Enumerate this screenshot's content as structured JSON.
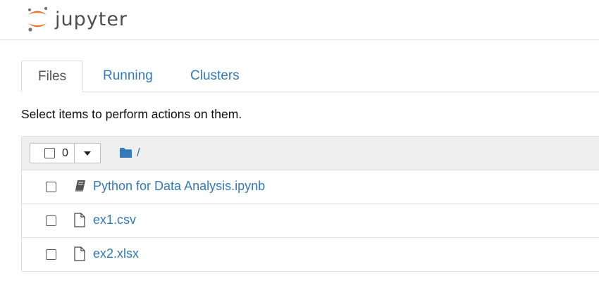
{
  "header": {
    "logo_text": "jupyter",
    "colors": {
      "logo_orange": "#f37626",
      "logo_gray": "#767677"
    }
  },
  "tabs": [
    {
      "label": "Files",
      "active": true
    },
    {
      "label": "Running",
      "active": false
    },
    {
      "label": "Clusters",
      "active": false
    }
  ],
  "instructions": "Select items to perform actions on them.",
  "toolbar": {
    "selected_count": "0",
    "breadcrumb_separator": "/"
  },
  "items": [
    {
      "name": "Python for Data Analysis.ipynb",
      "icon": "notebook-icon"
    },
    {
      "name": "ex1.csv",
      "icon": "file-icon"
    },
    {
      "name": "ex2.xlsx",
      "icon": "file-icon"
    }
  ],
  "colors": {
    "link": "#337ab7",
    "list_header_bg": "#eeeeee",
    "border": "#dddddd"
  }
}
